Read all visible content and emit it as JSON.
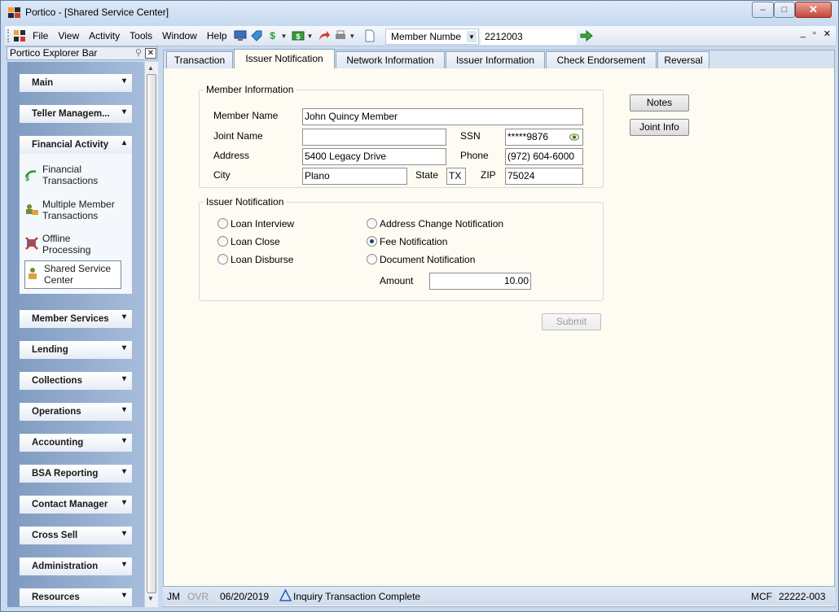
{
  "window": {
    "title": "Portico - [Shared Service Center]",
    "controls": {
      "minimize": "–",
      "maximize": "□",
      "close": "✕"
    }
  },
  "menubar": {
    "items": [
      "File",
      "View",
      "Activity",
      "Tools",
      "Window",
      "Help"
    ]
  },
  "toolbar": {
    "search_type": "Member Numbe",
    "search_value": "2212003",
    "mdi_controls": [
      "_",
      "▫",
      "✕"
    ]
  },
  "explorer": {
    "title": "Portico Explorer Bar",
    "sections": [
      {
        "label": "Main",
        "chevron": "▾"
      },
      {
        "label": "Teller Managem...",
        "chevron": "▾"
      },
      {
        "label": "Financial Activity",
        "chevron": "▴"
      },
      {
        "label": "Member Services",
        "chevron": "▾"
      },
      {
        "label": "Lending",
        "chevron": "▾"
      },
      {
        "label": "Collections",
        "chevron": "▾"
      },
      {
        "label": "Operations",
        "chevron": "▾"
      },
      {
        "label": "Accounting",
        "chevron": "▾"
      },
      {
        "label": "BSA Reporting",
        "chevron": "▾"
      },
      {
        "label": "Contact Manager",
        "chevron": "▾"
      },
      {
        "label": "Cross Sell",
        "chevron": "▾"
      },
      {
        "label": "Administration",
        "chevron": "▾"
      },
      {
        "label": "Resources",
        "chevron": "▾"
      }
    ],
    "financial_items": [
      {
        "line1": "Financial",
        "line2": "Transactions"
      },
      {
        "line1": "Multiple Member",
        "line2": "Transactions"
      },
      {
        "line1": "Offline",
        "line2": "Processing"
      },
      {
        "line1": "Shared Service",
        "line2": "Center",
        "selected": true
      }
    ]
  },
  "tabs": [
    {
      "label": "Transaction",
      "active": false
    },
    {
      "label": "Issuer Notification",
      "active": true
    },
    {
      "label": "Network Information",
      "active": false
    },
    {
      "label": "Issuer Information",
      "active": false
    },
    {
      "label": "Check Endorsement",
      "active": false
    },
    {
      "label": "Reversal",
      "active": false
    }
  ],
  "member_info": {
    "legend": "Member Information",
    "member_name_label": "Member Name",
    "member_name": "John Quincy Member",
    "joint_name_label": "Joint Name",
    "joint_name": "",
    "address_label": "Address",
    "address": "5400 Legacy Drive",
    "city_label": "City",
    "city": "Plano",
    "state_label": "State",
    "state": "TX",
    "zip_label": "ZIP",
    "zip": "75024",
    "ssn_label": "SSN",
    "ssn": "*****9876",
    "phone_label": "Phone",
    "phone": "(972) 604-6000"
  },
  "issuer_notification": {
    "legend": "Issuer Notification",
    "options_left": [
      "Loan Interview",
      "Loan Close",
      "Loan Disburse"
    ],
    "options_right": [
      "Address Change Notification",
      "Fee Notification",
      "Document Notification"
    ],
    "selected": "Fee Notification",
    "amount_label": "Amount",
    "amount": "10.00"
  },
  "buttons": {
    "notes": "Notes",
    "joint_info": "Joint Info",
    "submit": "Submit"
  },
  "status": {
    "user": "JM",
    "ovr": "OVR",
    "date": "06/20/2019",
    "message": "Inquiry Transaction Complete",
    "mode": "MCF",
    "code": "22222-003"
  }
}
